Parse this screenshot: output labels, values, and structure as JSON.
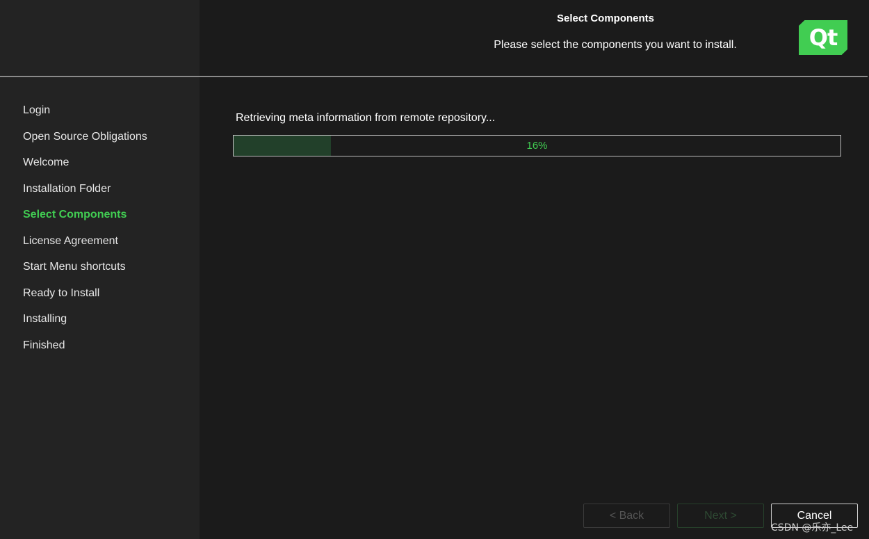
{
  "header": {
    "title": "Select Components",
    "subtitle": "Please select the components you want to install.",
    "logo_text": "Qt"
  },
  "sidebar": {
    "steps": [
      {
        "label": "Login",
        "active": false
      },
      {
        "label": "Open Source Obligations",
        "active": false
      },
      {
        "label": "Welcome",
        "active": false
      },
      {
        "label": "Installation Folder",
        "active": false
      },
      {
        "label": "Select Components",
        "active": true
      },
      {
        "label": "License Agreement",
        "active": false
      },
      {
        "label": "Start Menu shortcuts",
        "active": false
      },
      {
        "label": "Ready to Install",
        "active": false
      },
      {
        "label": "Installing",
        "active": false
      },
      {
        "label": "Finished",
        "active": false
      }
    ]
  },
  "main": {
    "status_text": "Retrieving meta information from remote repository...",
    "progress_value": 16,
    "progress_label": "16%"
  },
  "buttons": {
    "back": "< Back",
    "next": "Next >",
    "cancel": "Cancel"
  },
  "watermark": "CSDN @乐亦_Lee",
  "colors": {
    "accent": "#41cd52",
    "background": "#1b1b1b",
    "sidebar": "#232323",
    "progress_fill": "#22402a"
  }
}
